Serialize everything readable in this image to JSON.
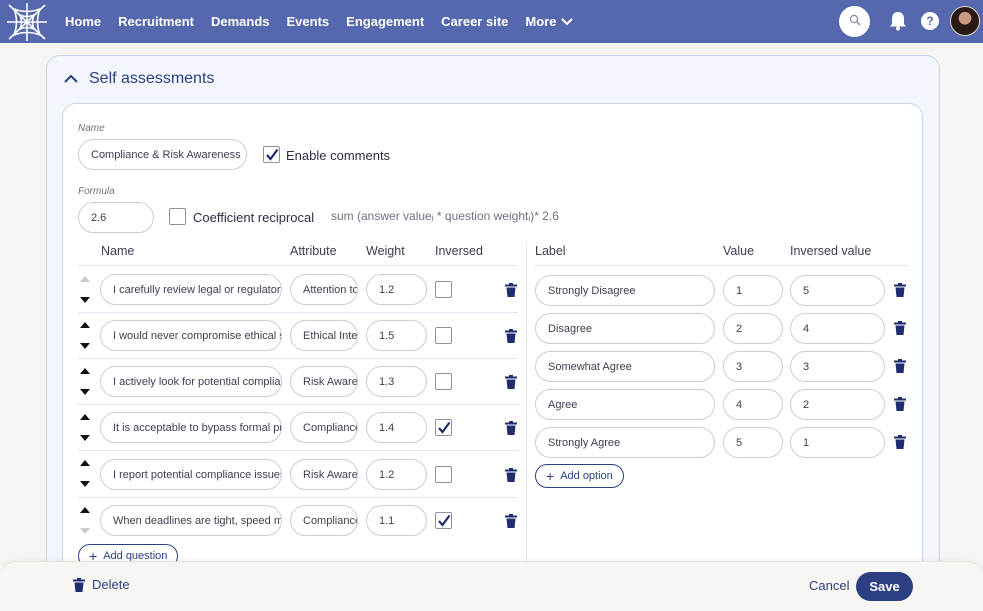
{
  "nav": {
    "items": [
      {
        "label": "Home"
      },
      {
        "label": "Recruitment"
      },
      {
        "label": "Demands"
      },
      {
        "label": "Events"
      },
      {
        "label": "Engagement"
      },
      {
        "label": "Career site"
      },
      {
        "label": "More"
      }
    ],
    "help_label": "?"
  },
  "section": {
    "title": "Self assessments"
  },
  "form": {
    "name_label": "Name",
    "name_value": "Compliance & Risk Awareness",
    "enable_comments_label": "Enable comments",
    "enable_comments_checked": true,
    "formula_label": "Formula",
    "formula_value": "2.6",
    "coefficient_reciprocal_label": "Coefficient reciprocal",
    "coefficient_reciprocal_checked": false,
    "formula_expression": "sum (answer valueᵢ * question weightᵢ)* 2.6"
  },
  "questions": {
    "headers": {
      "name": "Name",
      "attribute": "Attribute",
      "weight": "Weight",
      "inversed": "Inversed"
    },
    "rows": [
      {
        "name": "I carefully review legal or regulatory requirements",
        "attribute": "Attention to detail",
        "weight": "1.2",
        "inversed": false
      },
      {
        "name": "I would never compromise ethical standards",
        "attribute": "Ethical Integrity",
        "weight": "1.5",
        "inversed": false
      },
      {
        "name": "I actively look for potential compliance risks",
        "attribute": "Risk Awareness",
        "weight": "1.3",
        "inversed": false
      },
      {
        "name": "It is acceptable to bypass formal procedures",
        "attribute": "Compliance",
        "weight": "1.4",
        "inversed": true
      },
      {
        "name": "I report potential compliance issues",
        "attribute": "Risk Awareness",
        "weight": "1.2",
        "inversed": false
      },
      {
        "name": "When deadlines are tight, speed matters more",
        "attribute": "Compliance",
        "weight": "1.1",
        "inversed": true
      }
    ],
    "add_label": "Add question"
  },
  "options": {
    "headers": {
      "label": "Label",
      "value": "Value",
      "inversed_value": "Inversed value"
    },
    "rows": [
      {
        "label": "Strongly Disagree",
        "value": "1",
        "inversed_value": "5"
      },
      {
        "label": "Disagree",
        "value": "2",
        "inversed_value": "4"
      },
      {
        "label": "Somewhat Agree",
        "value": "3",
        "inversed_value": "3"
      },
      {
        "label": "Agree",
        "value": "4",
        "inversed_value": "2"
      },
      {
        "label": "Strongly Agree",
        "value": "5",
        "inversed_value": "1"
      }
    ],
    "add_label": "Add option"
  },
  "footer": {
    "delete_label": "Delete",
    "cancel_label": "Cancel",
    "save_label": "Save"
  },
  "colors": {
    "nav_bg": "#5568ad",
    "accent": "#2c3f82"
  },
  "icons": {
    "logo": "spiderweb-logo",
    "search": "search-icon",
    "bell": "bell-icon",
    "help": "help-icon",
    "collapse": "chevron-up-icon",
    "delete": "trash-icon",
    "move_up": "arrow-up-icon",
    "move_down": "arrow-down-icon"
  }
}
